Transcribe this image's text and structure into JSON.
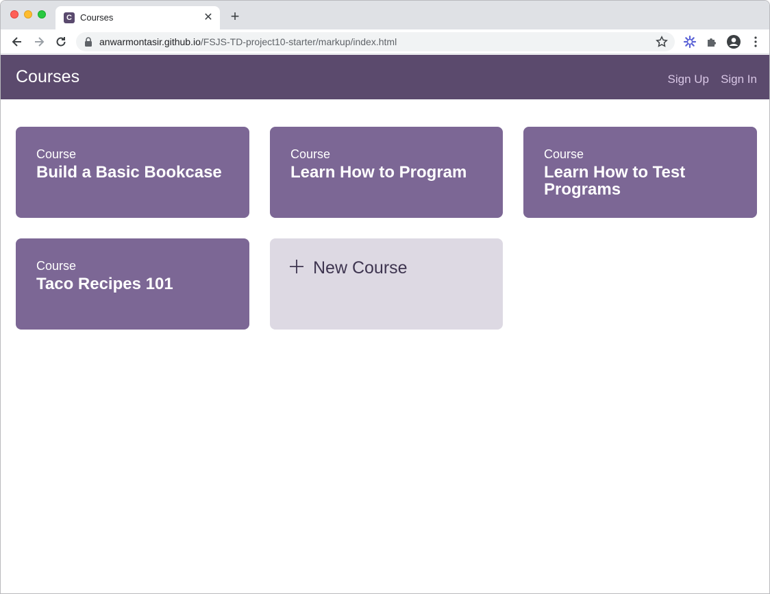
{
  "browser": {
    "tab_title": "Courses",
    "favicon_letter": "C",
    "url_host": "anwarmontasir.github.io",
    "url_path": "/FSJS-TD-project10-starter/markup/index.html"
  },
  "header": {
    "title": "Courses",
    "sign_up": "Sign Up",
    "sign_in": "Sign In"
  },
  "courses": [
    {
      "label": "Course",
      "title": "Build a Basic Bookcase"
    },
    {
      "label": "Course",
      "title": "Learn How to Program"
    },
    {
      "label": "Course",
      "title": "Learn How to Test Programs"
    },
    {
      "label": "Course",
      "title": "Taco Recipes 101"
    }
  ],
  "new_course": {
    "label": "New Course"
  },
  "colors": {
    "header_bg": "#5b4a6d",
    "card_bg": "#7c6795",
    "new_card_bg": "#ddd9e3",
    "header_link": "#d9c7e6"
  }
}
